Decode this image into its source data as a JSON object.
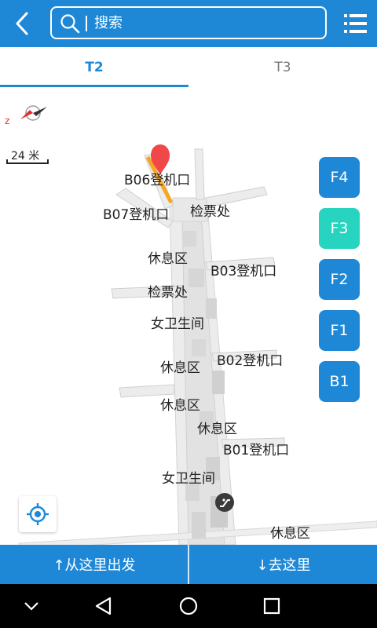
{
  "header": {
    "search_placeholder": "搜索",
    "icons": {
      "back": "chevron-left-icon",
      "search": "search-icon",
      "list": "list-icon"
    }
  },
  "tabs": [
    {
      "label": "T2",
      "active": true
    },
    {
      "label": "T3",
      "active": false
    }
  ],
  "map": {
    "scale_text": "24 米",
    "labels": {
      "b06": "B06登机口",
      "b07": "B07登机口",
      "checkin1": "检票处",
      "rest1": "休息区",
      "b03": "B03登机口",
      "checkin2": "检票处",
      "restroom1": "女卫生间",
      "rest2": "休息区",
      "b02": "B02登机口",
      "rest3": "休息区",
      "rest4": "休息区",
      "b01": "B01登机口",
      "restroom2": "女卫生间",
      "rest5": "休息区"
    },
    "colors": {
      "accent": "#1e88d6",
      "active_floor": "#26d4bf",
      "marker": "#f04848",
      "route": "#f5a623"
    }
  },
  "floors": [
    {
      "label": "F4",
      "active": false
    },
    {
      "label": "F3",
      "active": true
    },
    {
      "label": "F2",
      "active": false
    },
    {
      "label": "F1",
      "active": false
    },
    {
      "label": "B1",
      "active": false
    }
  ],
  "actions": {
    "from_here": "↑从这里出发",
    "to_here": "↓去这里"
  }
}
